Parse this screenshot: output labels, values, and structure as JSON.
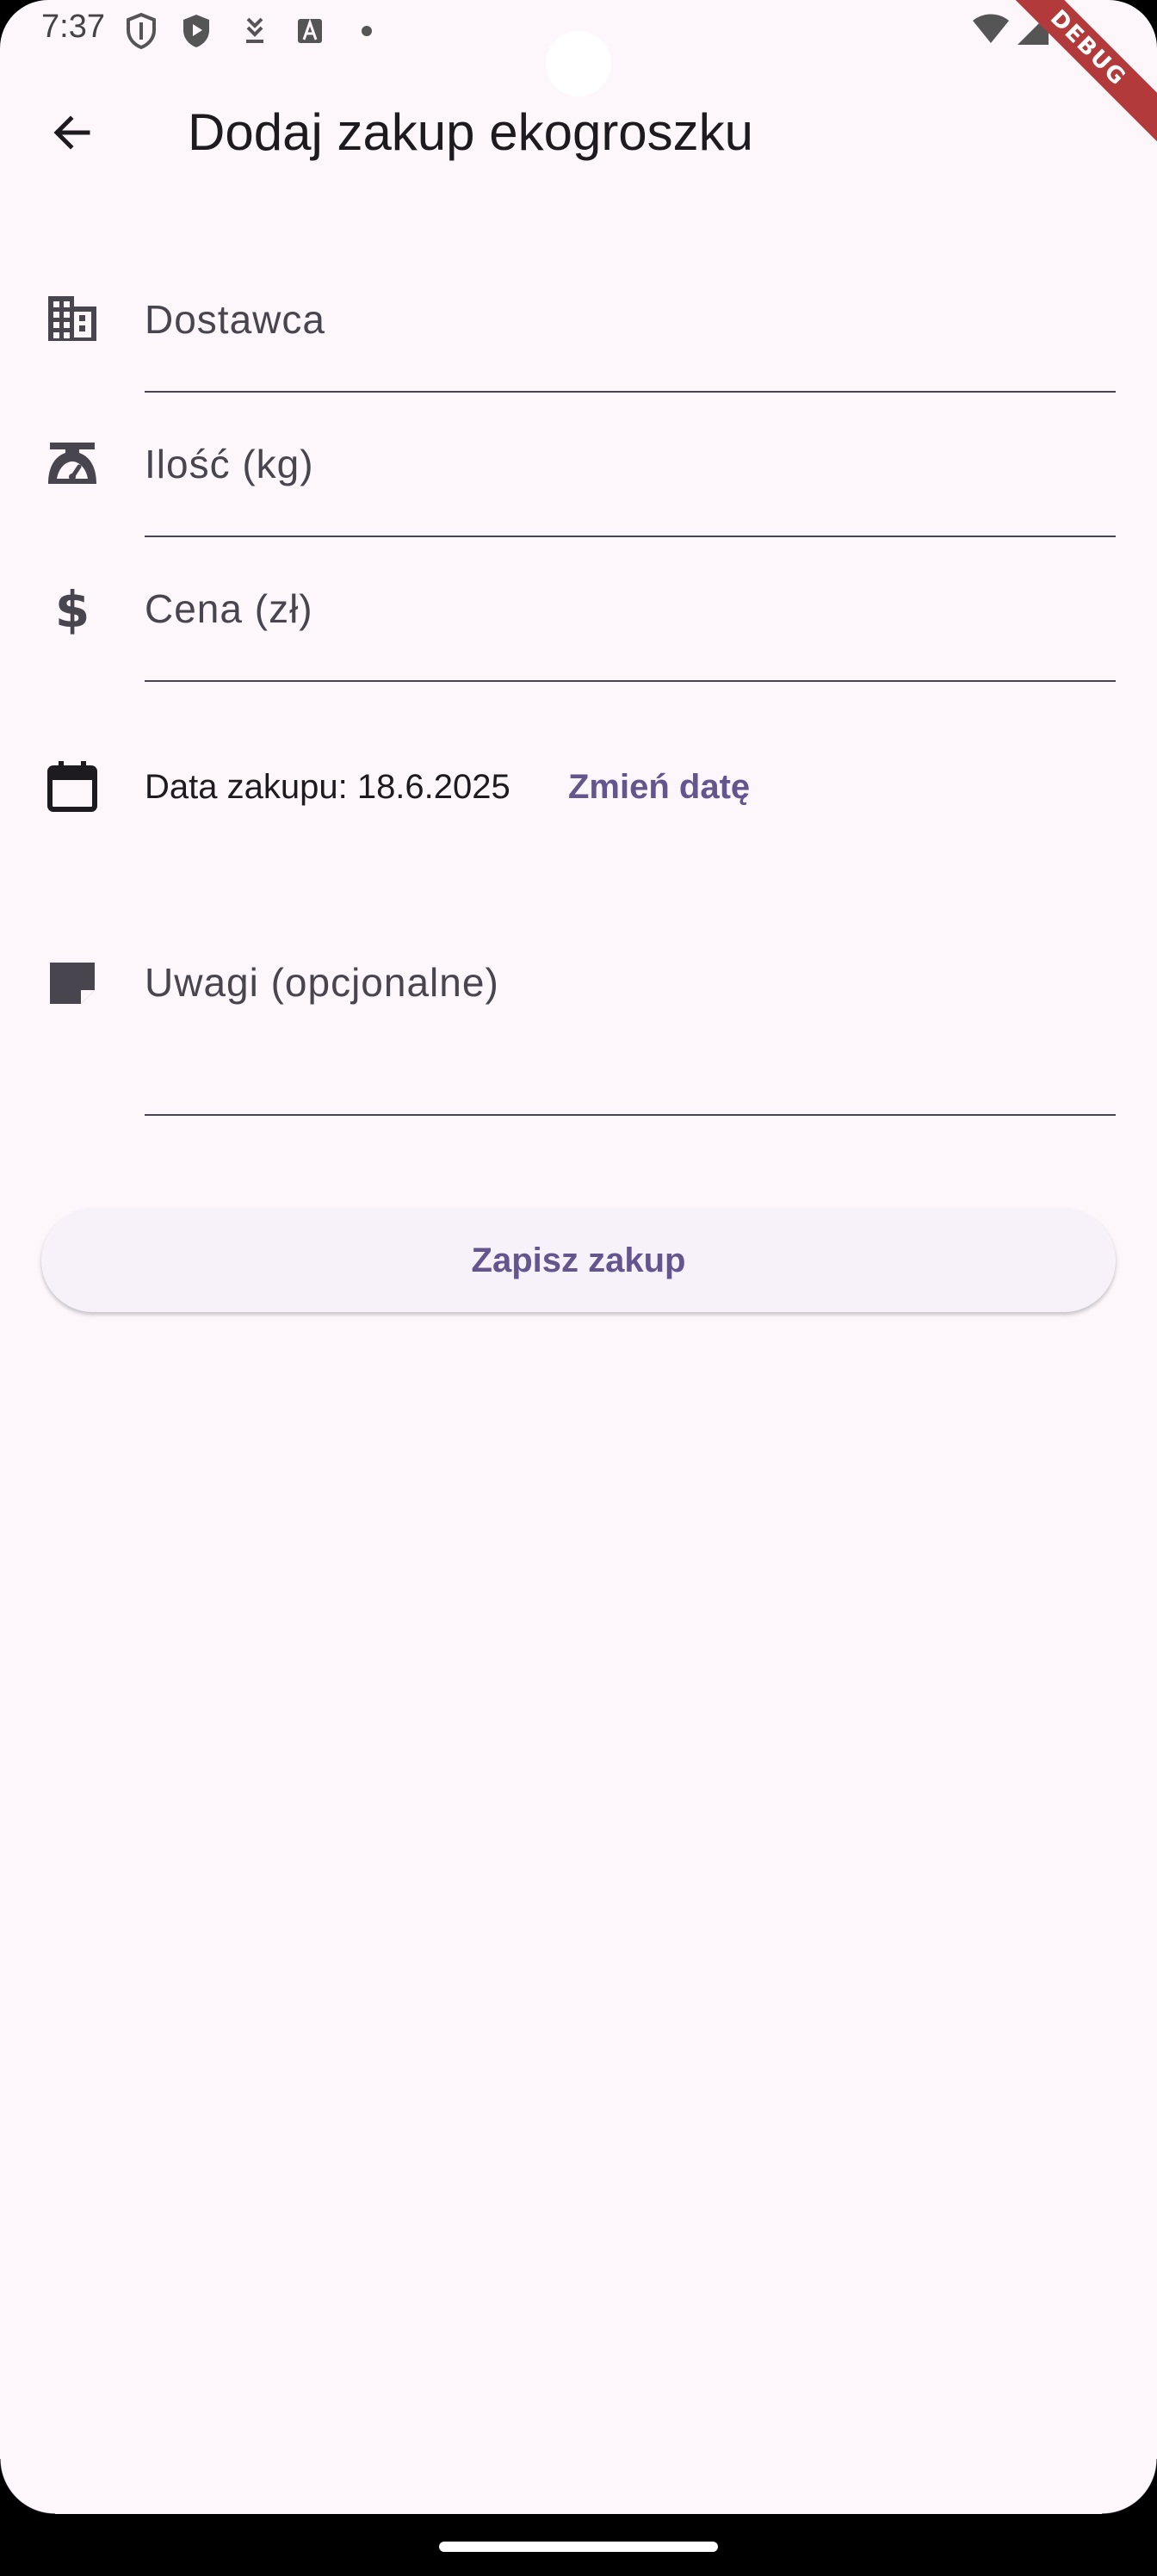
{
  "status_bar": {
    "time": "7:37",
    "left_icons": [
      "shield-outline-icon",
      "shield-play-icon",
      "download-icon",
      "font-a-icon",
      "dot-icon"
    ],
    "right_icons": [
      "wifi-icon",
      "signal-icon",
      "battery-icon"
    ]
  },
  "debug_banner": "DEBUG",
  "app_bar": {
    "title": "Dodaj zakup ekogroszku"
  },
  "form": {
    "supplier_label": "Dostawca",
    "quantity_label": "Ilość (kg)",
    "price_label": "Cena (zł)",
    "date_text": "Data zakupu: 18.6.2025",
    "change_date_label": "Zmień datę",
    "notes_label": "Uwagi (opcjonalne)"
  },
  "save_button_label": "Zapisz zakup",
  "colors": {
    "background": "#fdf7fc",
    "accent": "#65558f",
    "text": "#1d1b20",
    "label": "#49454f"
  }
}
